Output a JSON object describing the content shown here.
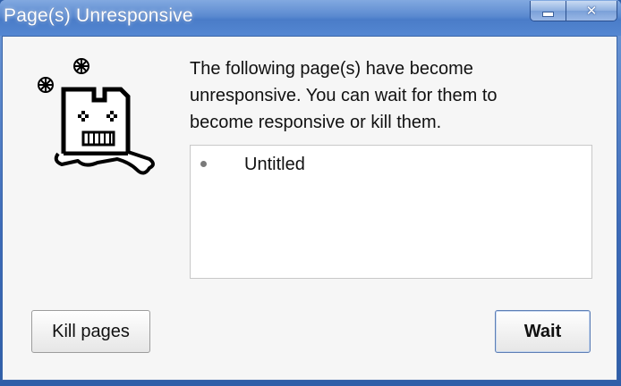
{
  "window": {
    "title": "Page(s) Unresponsive",
    "minimize_icon": "minimize-icon",
    "close_icon": "close-icon",
    "close_glyph": "✕",
    "accent_color": "#4a7cc8"
  },
  "illustration": {
    "icon": "frozen-sad-tab-icon",
    "snowflake_icon": "snowflake-icon"
  },
  "message": {
    "line1": "The following page(s) have become",
    "line2": "unresponsive. You can wait for them to",
    "line3": "become responsive or kill them."
  },
  "pages": [
    {
      "name": "Untitled"
    }
  ],
  "buttons": {
    "kill_label": "Kill pages",
    "wait_label": "Wait"
  }
}
